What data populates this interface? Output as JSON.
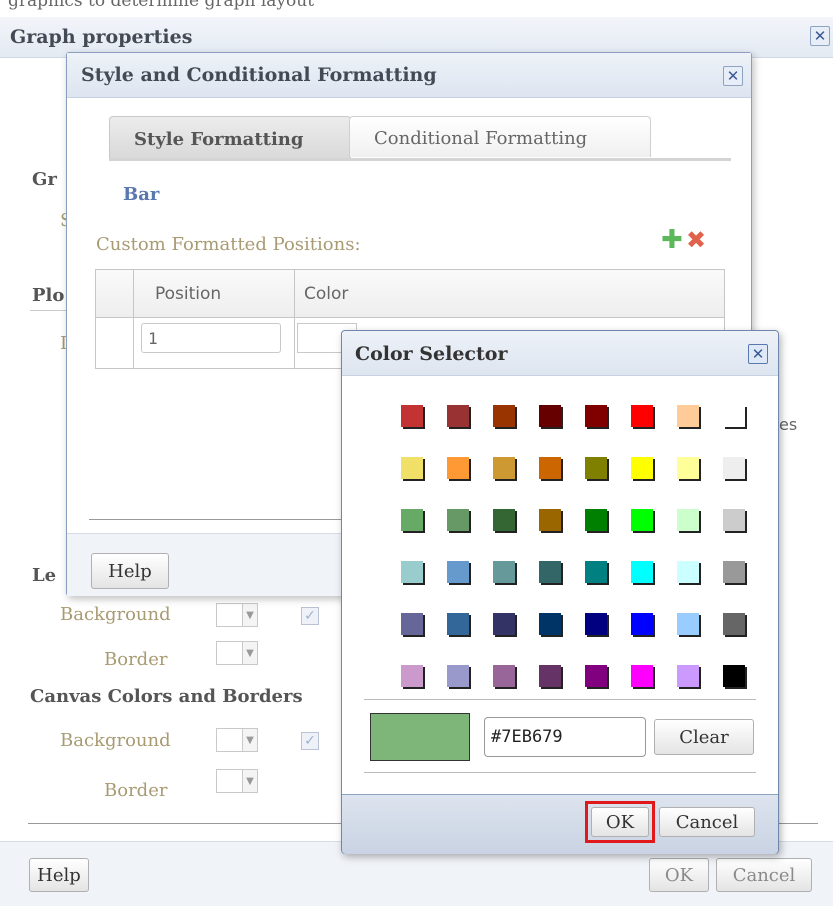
{
  "bg_text": "graphics to determine graph layout",
  "graph_props": {
    "title": "Graph properties",
    "close": "✕",
    "partial_labels": {
      "gr": "Gr",
      "s": "S",
      "plo": "Plo",
      "l": "I",
      "le": "Le",
      "es": "es"
    },
    "legend_background_label": "Background",
    "legend_border_label": "Border",
    "canvas_heading": "Canvas Colors and Borders",
    "canvas_background_label": "Background",
    "canvas_border_label": "Border",
    "help": "Help",
    "ok": "OK",
    "cancel": "Cancel"
  },
  "style_dialog": {
    "title": "Style and Conditional Formatting",
    "close": "✕",
    "tabs": [
      "Style Formatting",
      "Conditional Formatting"
    ],
    "section": "Bar",
    "custom_label": "Custom Formatted Positions:",
    "columns": [
      "Position",
      "Color"
    ],
    "row_position_value": "1",
    "help": "Help"
  },
  "color_selector": {
    "title": "Color Selector",
    "close": "✕",
    "palette": [
      [
        "#c33333",
        "#993333",
        "#993300",
        "#660000",
        "#800000",
        "#ff0000",
        "#ffcc99",
        "#ffffff"
      ],
      [
        "#f0e068",
        "#ff9933",
        "#cc9933",
        "#cc6600",
        "#808000",
        "#ffff00",
        "#ffff99",
        "#eeeeee"
      ],
      [
        "#66aa66",
        "#669966",
        "#336633",
        "#996600",
        "#008000",
        "#00ff00",
        "#ccffcc",
        "#cccccc"
      ],
      [
        "#99cccc",
        "#6699cc",
        "#669999",
        "#336666",
        "#008080",
        "#00ffff",
        "#ccffff",
        "#999999"
      ],
      [
        "#666699",
        "#336699",
        "#333366",
        "#003366",
        "#000080",
        "#0000ff",
        "#99ccff",
        "#666666"
      ],
      [
        "#cc99cc",
        "#9999cc",
        "#996699",
        "#663366",
        "#800080",
        "#ff00ff",
        "#cc99ff",
        "#000000"
      ]
    ],
    "preview_color": "#7EB679",
    "hex_value": "#7EB679",
    "clear": "Clear",
    "ok": "OK",
    "cancel": "Cancel"
  },
  "icons": {
    "add": "plus-icon",
    "remove": "delete-x-icon"
  },
  "colors": {
    "accent_tan": "#a89a72",
    "header_blue": "#dce4f0",
    "highlight_red": "#e01a1a",
    "link_blue": "#5a78b0"
  }
}
